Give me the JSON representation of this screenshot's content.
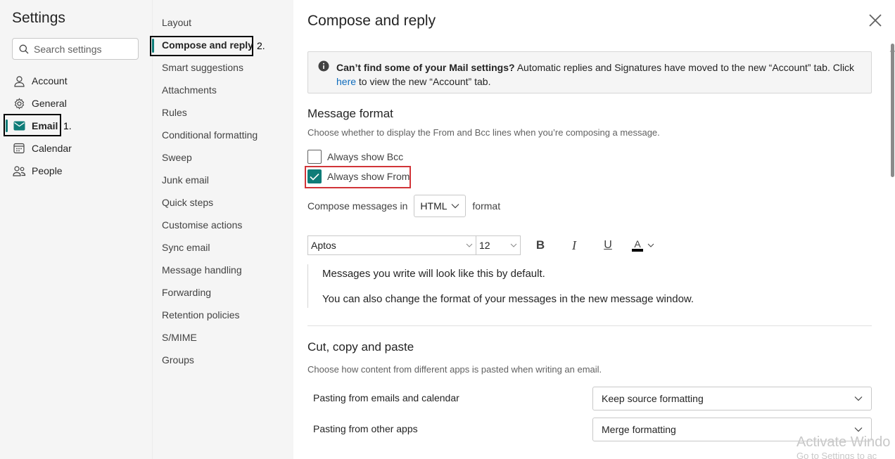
{
  "left": {
    "title": "Settings",
    "search": {
      "placeholder": "Search settings"
    },
    "categories": [
      {
        "label": "Account",
        "icon": "person-icon"
      },
      {
        "label": "General",
        "icon": "gear-icon"
      },
      {
        "label": "Email",
        "icon": "mail-icon"
      },
      {
        "label": "Calendar",
        "icon": "calendar-icon"
      },
      {
        "label": "People",
        "icon": "people-icon"
      }
    ],
    "annotation": "1."
  },
  "middle": {
    "items": [
      "Layout",
      "Compose and reply",
      "Smart suggestions",
      "Attachments",
      "Rules",
      "Conditional formatting",
      "Sweep",
      "Junk email",
      "Quick steps",
      "Customise actions",
      "Sync email",
      "Message handling",
      "Forwarding",
      "Retention policies",
      "S/MIME",
      "Groups"
    ],
    "annotation": "2."
  },
  "content": {
    "title": "Compose and reply",
    "banner": {
      "bold": "Can’t find some of your Mail settings?",
      "text1": " Automatic replies and Signatures have moved to the new “Account” tab. Click ",
      "link": "here",
      "text2": " to view the new “Account” tab."
    },
    "message_format": {
      "heading": "Message format",
      "desc": "Choose whether to display the From and Bcc lines when you’re composing a message.",
      "bcc_label": "Always show Bcc",
      "bcc_checked": false,
      "from_label": "Always show From",
      "from_checked": true,
      "compose_prefix": "Compose messages in",
      "compose_value": "HTML",
      "compose_suffix": "format",
      "font_name": "Aptos",
      "font_size": "12",
      "bold_glyph": "B",
      "italic_glyph": "I",
      "underline_glyph": "U",
      "font_color_glyph": "A",
      "preview_line1": "Messages you write will look like this by default.",
      "preview_line2": "You can also change the format of your messages in the new message window."
    },
    "paste": {
      "heading": "Cut, copy and paste",
      "desc": "Choose how content from different apps is pasted when writing an email.",
      "rows": [
        {
          "label": "Pasting from emails and calendar",
          "value": "Keep source formatting"
        },
        {
          "label": "Pasting from other apps",
          "value": "Merge formatting"
        }
      ]
    }
  },
  "watermark": {
    "line1": "Activate Windo",
    "line2": "Go to Settings to ac"
  },
  "colors": {
    "accent": "#0f7c78",
    "link": "#0f6cbd",
    "highlight": "#d13438"
  }
}
